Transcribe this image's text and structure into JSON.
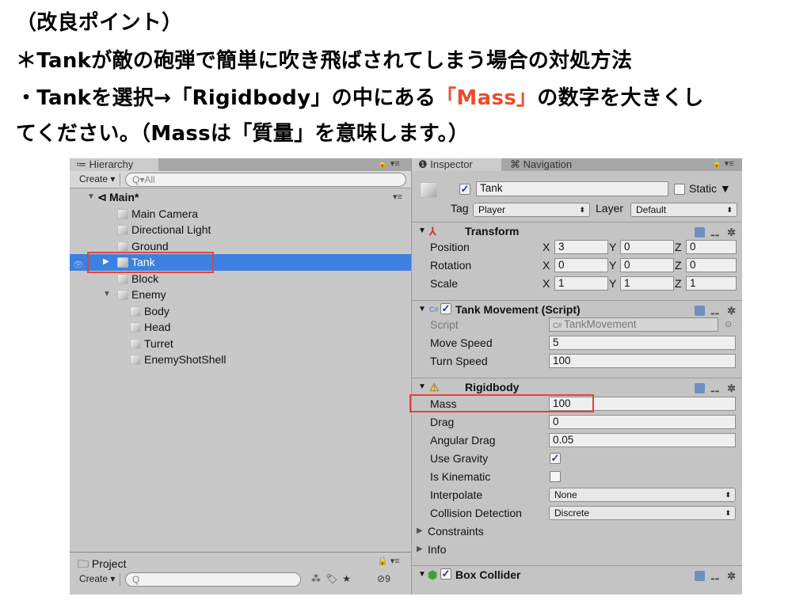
{
  "slide": {
    "line1": "（改良ポイント）",
    "line2": "＊Tankが敵の砲弾で簡単に吹き飛ばされてしまう場合の対処方法",
    "line3_a": "・Tankを選択→「Rigidbody」の中にある",
    "line3_red": "「Mass」",
    "line3_b": "の数字を大きくし",
    "line4": "てください。（Massは「質量」を意味します。）"
  },
  "hierarchy": {
    "tab_label": "≔ Hierarchy",
    "lock_icons": "🔒 ▾≡",
    "create_label": "Create ▾",
    "search_placeholder": "Q▾All",
    "scene_name": "Main*",
    "scene_menu": "▾≡",
    "items": [
      {
        "label": "Main Camera"
      },
      {
        "label": "Directional Light"
      },
      {
        "label": "Ground"
      },
      {
        "label": "Tank"
      },
      {
        "label": "Block"
      },
      {
        "label": "Enemy"
      },
      {
        "label": "Body"
      },
      {
        "label": "Head"
      },
      {
        "label": "Turret"
      },
      {
        "label": "EnemyShotShell"
      }
    ]
  },
  "project": {
    "tab_label": "Project",
    "create_label": "Create ▾",
    "search_placeholder": "Q",
    "hidden_count": "9"
  },
  "inspector": {
    "tab_inspector": "Inspector",
    "tab_navigation": "Navigation",
    "object_name": "Tank",
    "static_label": "Static",
    "tag_label": "Tag",
    "tag_value": "Player",
    "layer_label": "Layer",
    "layer_value": "Default",
    "transform": {
      "title": "Transform",
      "position": {
        "label": "Position",
        "x": "3",
        "y": "0",
        "z": "0"
      },
      "rotation": {
        "label": "Rotation",
        "x": "0",
        "y": "0",
        "z": "0"
      },
      "scale": {
        "label": "Scale",
        "x": "1",
        "y": "1",
        "z": "1"
      }
    },
    "tank_movement": {
      "title": "Tank Movement (Script)",
      "script_label": "Script",
      "script_value": "TankMovement",
      "move_speed_label": "Move Speed",
      "move_speed_value": "5",
      "turn_speed_label": "Turn Speed",
      "turn_speed_value": "100"
    },
    "rigidbody": {
      "title": "Rigidbody",
      "mass_label": "Mass",
      "mass_value": "100",
      "drag_label": "Drag",
      "drag_value": "0",
      "angular_drag_label": "Angular Drag",
      "angular_drag_value": "0.05",
      "use_gravity_label": "Use Gravity",
      "use_gravity_checked": true,
      "is_kinematic_label": "Is Kinematic",
      "is_kinematic_checked": false,
      "interpolate_label": "Interpolate",
      "interpolate_value": "None",
      "collision_label": "Collision Detection",
      "collision_value": "Discrete",
      "constraints_label": "Constraints",
      "info_label": "Info"
    },
    "box_collider": {
      "title": "Box Collider"
    }
  },
  "colors": {
    "highlight_red": "#e2443b",
    "selection_blue": "#3d80df",
    "mass_text_red": "#ea4d2d"
  }
}
